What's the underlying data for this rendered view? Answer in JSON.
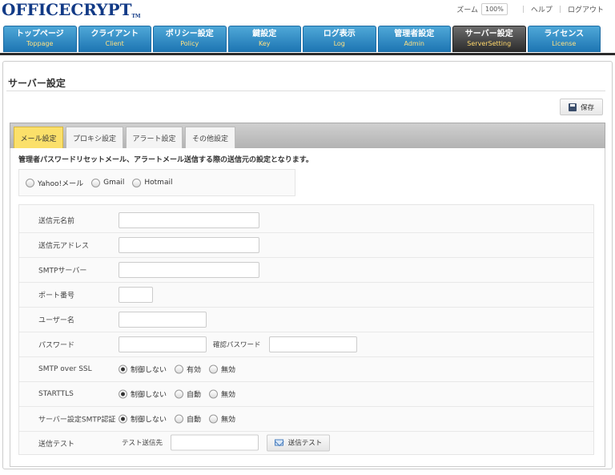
{
  "header": {
    "logo_text": "OFFICECRYPT",
    "logo_tm": "TM",
    "zoom_label": "ズーム",
    "zoom_value": "100%",
    "help_label": "ヘルプ",
    "logout_label": "ログアウト"
  },
  "nav": [
    {
      "ja": "トップページ",
      "en": "Toppage"
    },
    {
      "ja": "クライアント",
      "en": "Client"
    },
    {
      "ja": "ポリシー設定",
      "en": "Policy"
    },
    {
      "ja": "鍵設定",
      "en": "Key"
    },
    {
      "ja": "ログ表示",
      "en": "Log"
    },
    {
      "ja": "管理者設定",
      "en": "Admin"
    },
    {
      "ja": "サーバー設定",
      "en": "ServerSetting"
    },
    {
      "ja": "ライセンス",
      "en": "License"
    }
  ],
  "page": {
    "title": "サーバー設定",
    "save_label": "保存"
  },
  "tabs": [
    "メール設定",
    "プロキシ設定",
    "アラート設定",
    "その他設定"
  ],
  "mail": {
    "description": "管理者パスワードリセットメール、アラートメール送信する際の送信元の設定となります。",
    "providers": [
      "Yahoo!メール",
      "Gmail",
      "Hotmail"
    ],
    "fields": {
      "sender_name": {
        "label": "送信元名前",
        "value": ""
      },
      "sender_address": {
        "label": "送信元アドレス",
        "value": ""
      },
      "smtp_server": {
        "label": "SMTPサーバー",
        "value": ""
      },
      "port": {
        "label": "ポート番号",
        "value": ""
      },
      "username": {
        "label": "ユーザー名",
        "value": ""
      },
      "password": {
        "label": "パスワード",
        "value": "",
        "confirm_label": "確認パスワード"
      }
    },
    "smtp_ssl": {
      "label": "SMTP over SSL",
      "options": [
        "制御しない",
        "有効",
        "無効"
      ]
    },
    "starttls": {
      "label": "STARTTLS",
      "options": [
        "制御しない",
        "自動",
        "無効"
      ]
    },
    "smtp_auth": {
      "label": "サーバー設定SMTP認証",
      "options": [
        "制御しない",
        "自動",
        "無効"
      ]
    },
    "send_test": {
      "label": "送信テスト",
      "dest_label": "テスト送信先",
      "button_label": "送信テスト"
    }
  }
}
